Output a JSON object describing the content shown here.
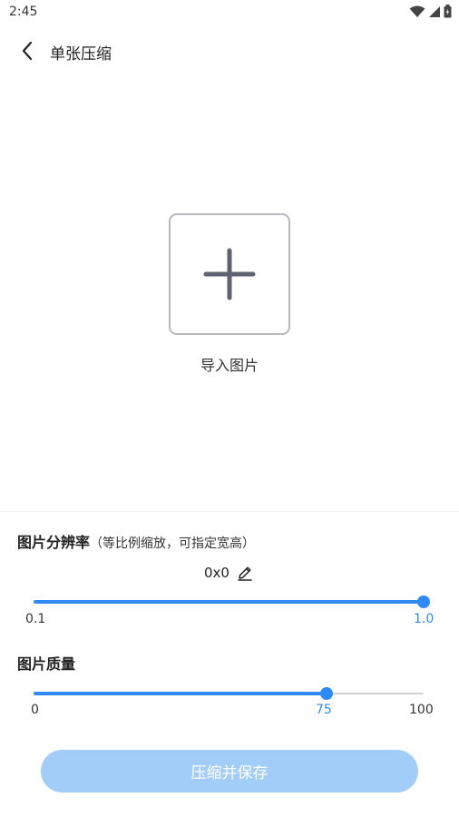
{
  "status_bar": {
    "time": "2:45",
    "icons": [
      "wifi-icon",
      "signal-icon",
      "battery-icon"
    ]
  },
  "app_bar": {
    "back_icon": "back-arrow-icon",
    "title": "单张压缩"
  },
  "import": {
    "icon": "plus-icon",
    "label": "导入图片"
  },
  "resolution": {
    "title": "图片分辨率",
    "hint": "（等比例缩放，可指定宽高）",
    "value": "0x0",
    "edit_icon": "pencil-icon",
    "slider": {
      "min_label": "0.1",
      "current_label": "1.0",
      "min": 0.1,
      "max": 1.0,
      "value": 1.0
    }
  },
  "quality": {
    "title": "图片质量",
    "slider": {
      "min_label": "0",
      "current_label": "75",
      "max_label": "100",
      "min": 0,
      "max": 100,
      "value": 75
    }
  },
  "compress_button": {
    "label": "压缩并保存"
  },
  "colors": {
    "accent": "#2f8af5",
    "button_disabled_bg": "#a3cdf9",
    "track": "#cfcfd4"
  }
}
